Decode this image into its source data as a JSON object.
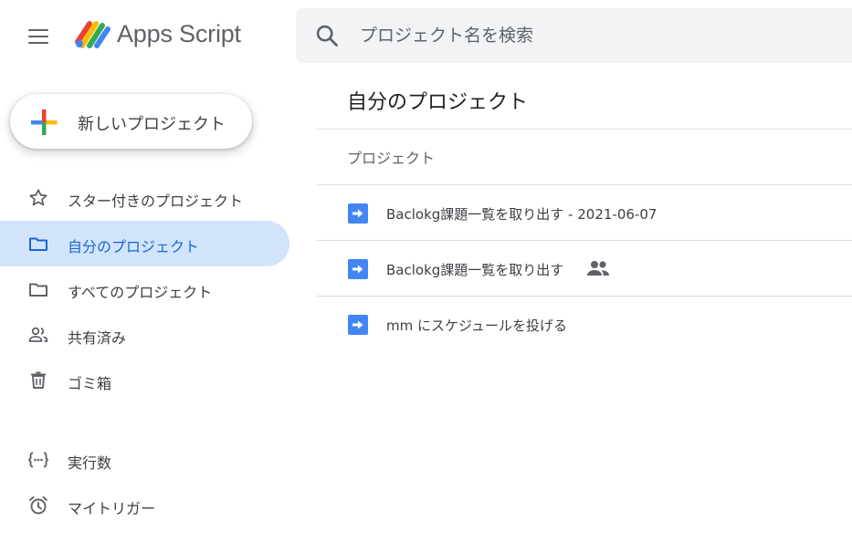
{
  "header": {
    "app_title": "Apps Script",
    "search_placeholder": "プロジェクト名を検索"
  },
  "sidebar": {
    "new_project_label": "新しいプロジェクト",
    "items": [
      {
        "label": "スター付きのプロジェクト",
        "icon": "star-icon"
      },
      {
        "label": "自分のプロジェクト",
        "icon": "folder-icon",
        "active": true
      },
      {
        "label": "すべてのプロジェクト",
        "icon": "folder-icon"
      },
      {
        "label": "共有済み",
        "icon": "people-icon"
      },
      {
        "label": "ゴミ箱",
        "icon": "trash-icon"
      },
      {
        "label": "実行数",
        "icon": "executions-icon"
      },
      {
        "label": "マイトリガー",
        "icon": "alarm-icon"
      }
    ]
  },
  "main": {
    "title": "自分のプロジェクト",
    "column_header": "プロジェクト",
    "projects": [
      {
        "name": "Baclokg課題一覧を取り出す - 2021-06-07",
        "shared": false
      },
      {
        "name": "Baclokg課題一覧を取り出す",
        "shared": true
      },
      {
        "name": "mm にスケジュールを投げる",
        "shared": false
      }
    ]
  },
  "colors": {
    "active_bg": "#d2e3fc",
    "active_text": "#1967d2",
    "project_icon": "#4285f4",
    "search_bg": "#f1f3f4"
  }
}
